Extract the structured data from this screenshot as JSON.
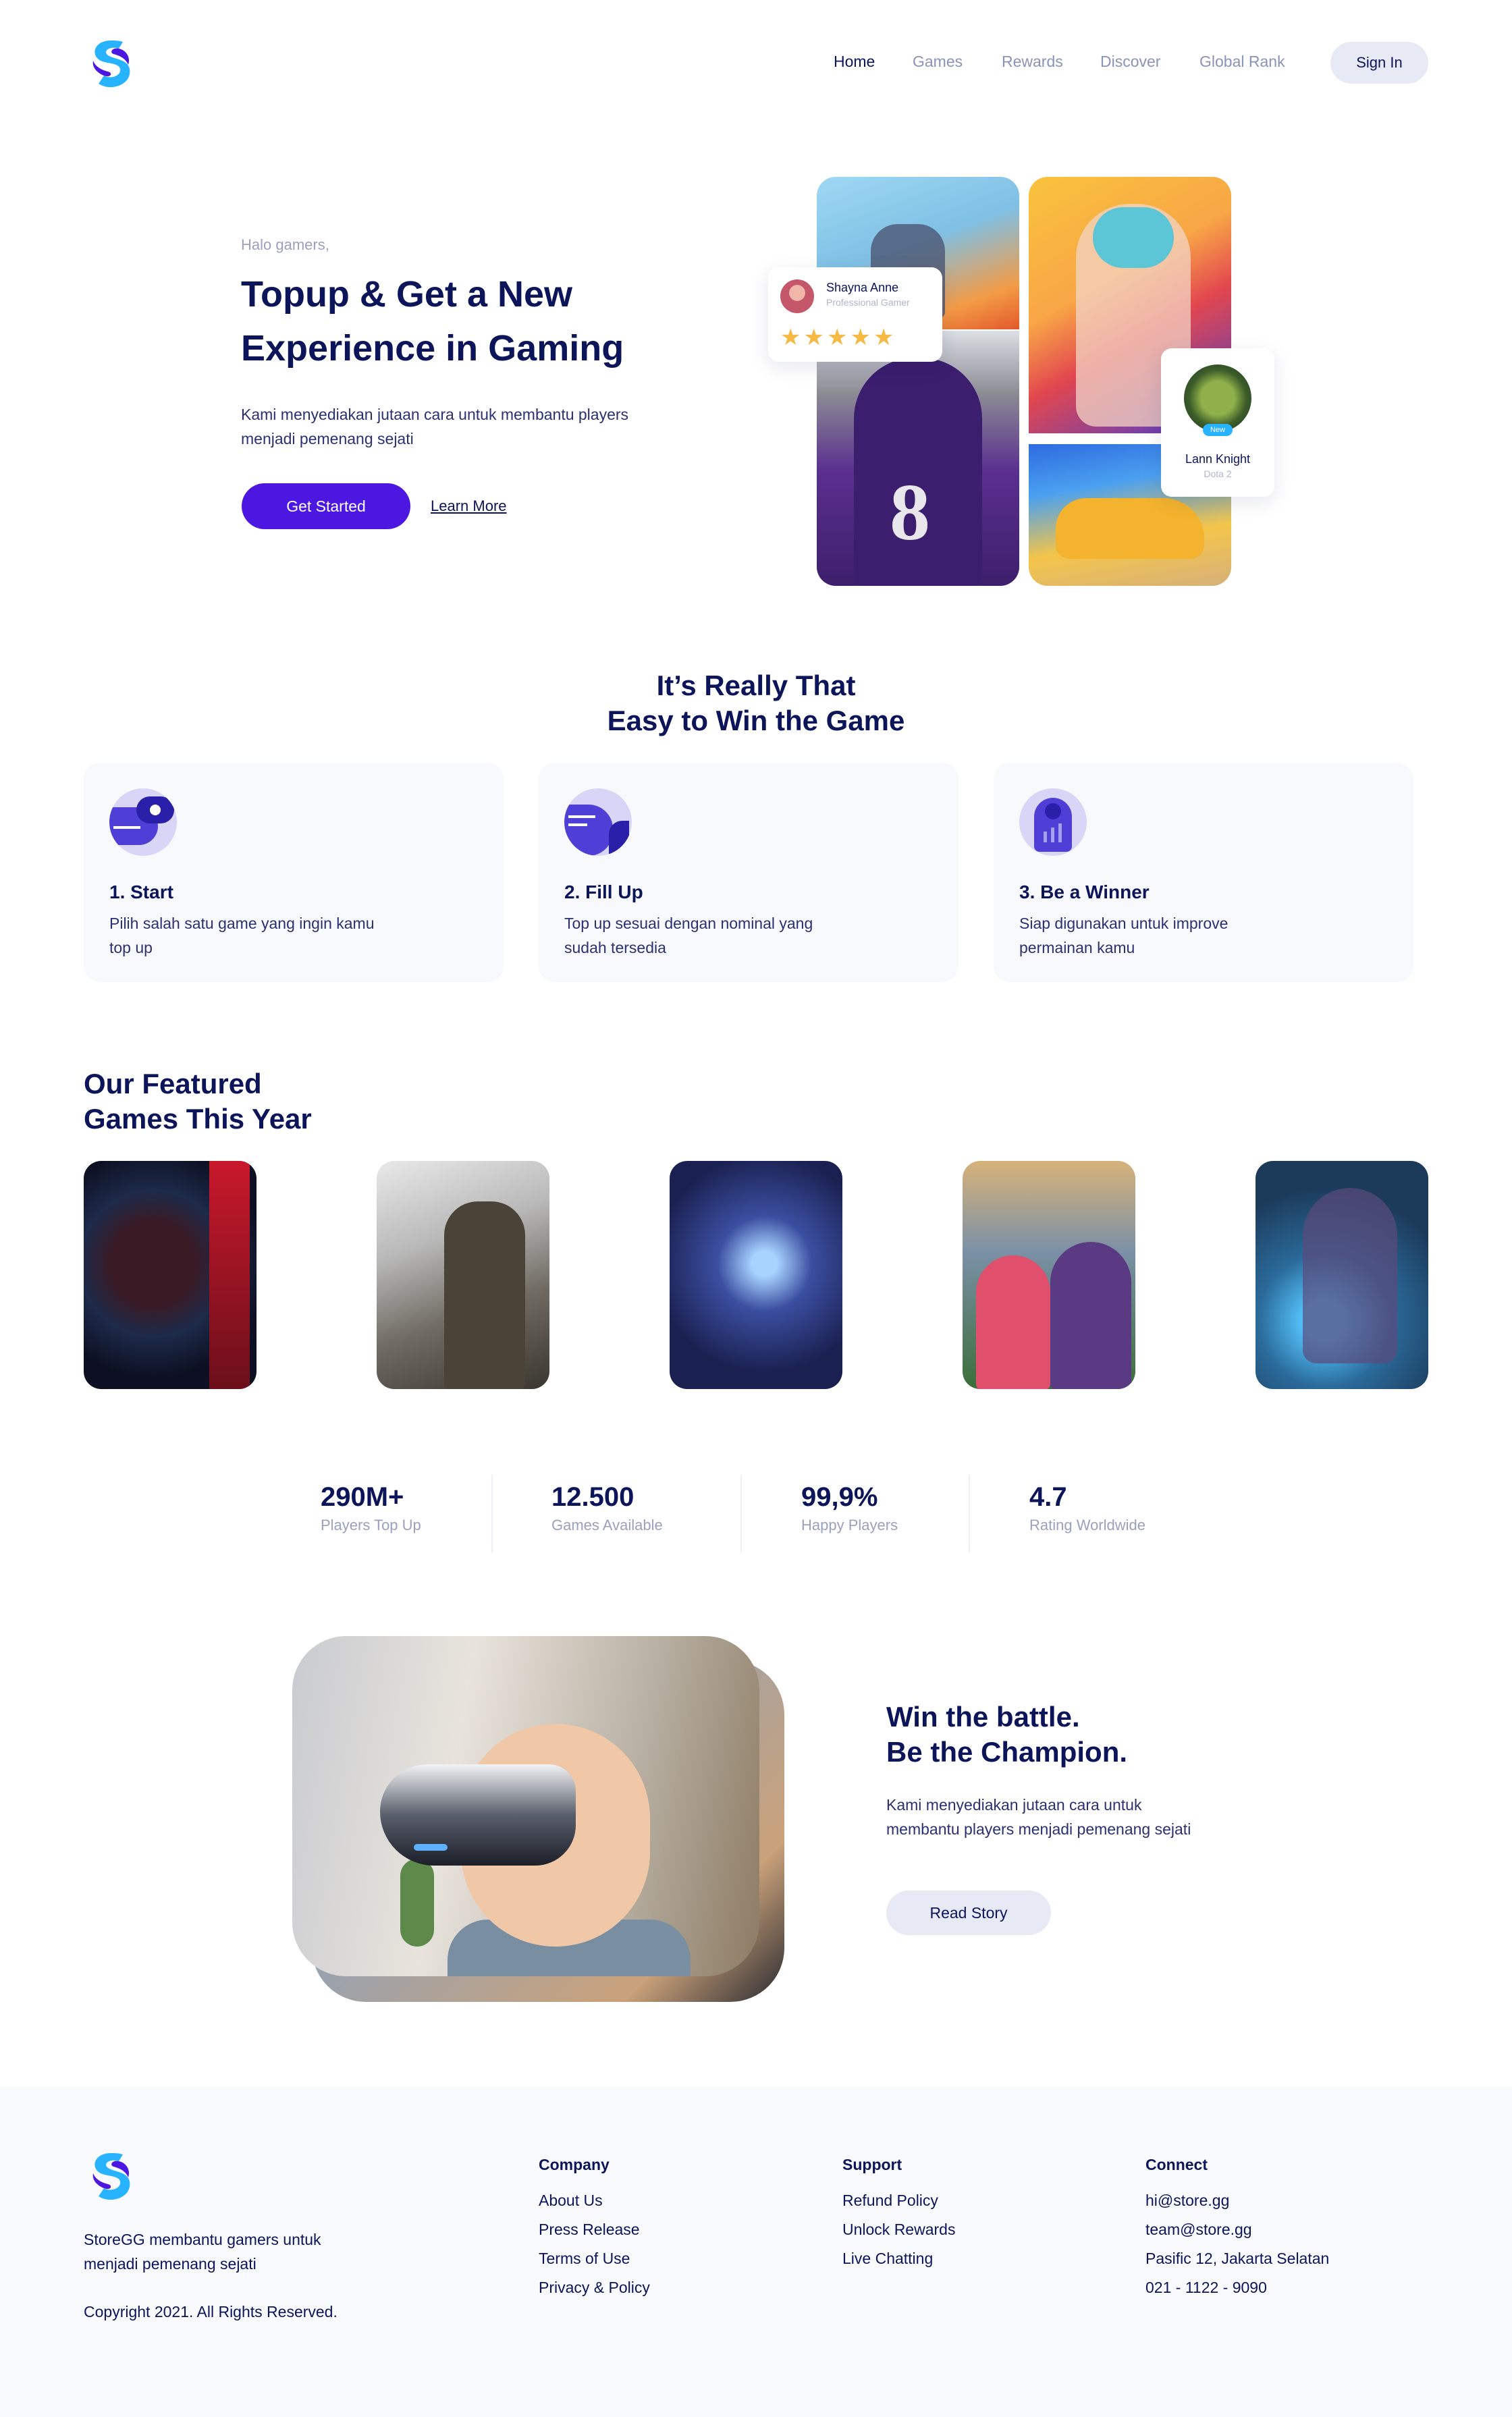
{
  "nav": {
    "links": [
      "Home",
      "Games",
      "Rewards",
      "Discover",
      "Global Rank"
    ],
    "signin_label": "Sign In"
  },
  "hero": {
    "greeting": "Halo gamers,",
    "title_part1": "Topup & Get a ",
    "title_highlight1": "New",
    "title_highlight2": "Experience",
    "title_part2": " in Gaming",
    "description": "Kami menyediakan jutaan cara untuk membantu players menjadi pemenang sejati",
    "cta_primary": "Get Started",
    "cta_secondary": "Learn More",
    "review_card": {
      "name": "Shayna Anne",
      "role": "Professional Gamer",
      "stars": "★★★★★"
    },
    "player_card": {
      "badge": "New",
      "name": "Lann Knight",
      "game": "Dota 2"
    },
    "tile_number": "8"
  },
  "steps": {
    "title_line1": "It’s Really That",
    "title_line2": "Easy to Win the Game",
    "items": [
      {
        "title": "1. Start",
        "desc": "Pilih salah satu game yang ingin kamu top up",
        "icon": "game-controller-icon"
      },
      {
        "title": "2. Fill Up",
        "desc": "Top up sesuai dengan nominal yang sudah tersedia",
        "icon": "wallet-icon"
      },
      {
        "title": "3. Be a Winner",
        "desc": "Siap digunakan untuk improve permainan kamu",
        "icon": "trophy-badge-icon"
      }
    ]
  },
  "featured": {
    "title_line1": "Our Featured",
    "title_line2": "Games This Year",
    "games": [
      "mass-effect",
      "call-of-duty",
      "dota-2",
      "clash-of-clans",
      "valorant"
    ]
  },
  "stats": [
    {
      "value": "290M+",
      "label": "Players Top Up"
    },
    {
      "value": "12.500",
      "label": "Games Available"
    },
    {
      "value": "99,9%",
      "label": "Happy Players"
    },
    {
      "value": "4.7",
      "label": "Rating Worldwide"
    }
  ],
  "story": {
    "title_line1": "Win the battle.",
    "title_line2": "Be the Champion.",
    "description": "Kami menyediakan jutaan cara untuk membantu players menjadi pemenang sejati",
    "cta": "Read Story"
  },
  "footer": {
    "tagline": "StoreGG membantu gamers untuk menjadi pemenang sejati",
    "copyright": "Copyright 2021. All Rights Reserved.",
    "columns": [
      {
        "title": "Company",
        "links": [
          "About Us",
          "Press Release",
          "Terms of Use",
          "Privacy & Policy"
        ]
      },
      {
        "title": "Support",
        "links": [
          "Refund Policy",
          "Unlock Rewards",
          "Live Chatting"
        ]
      },
      {
        "title": "Connect",
        "links": [
          "hi@store.gg",
          "team@store.gg",
          "Pasific 12, Jakarta Selatan",
          "021 - 1122 - 9090"
        ]
      }
    ]
  },
  "colors": {
    "primary": "#4d17e2",
    "navy": "#0c145a",
    "accent_blue": "#27b3ff",
    "muted": "#9aa0bf",
    "star": "#f5b944"
  }
}
